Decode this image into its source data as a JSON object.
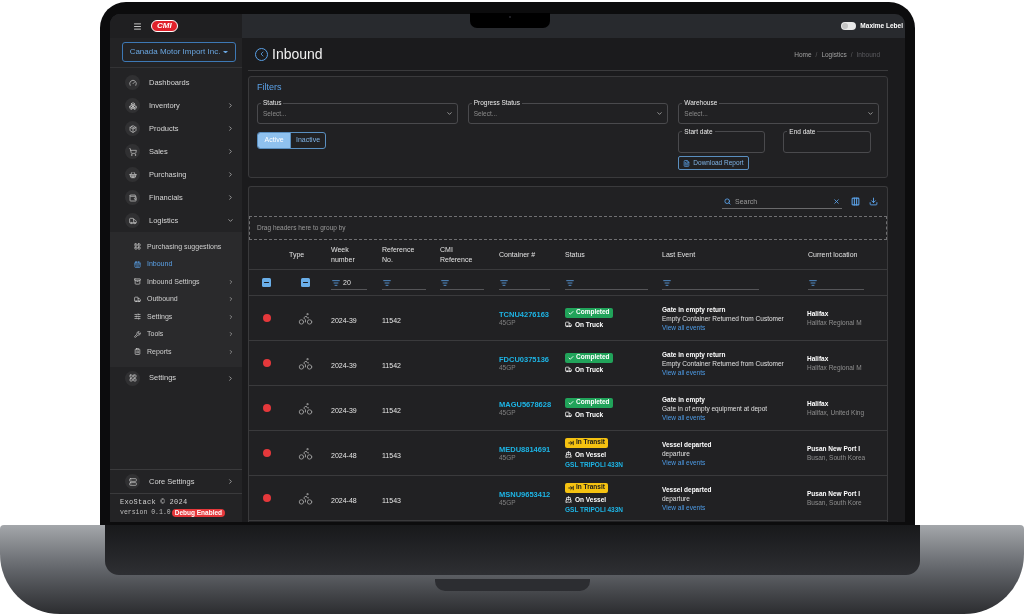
{
  "topbar": {
    "logo": "CMI",
    "theme_switch": {
      "on": false
    },
    "user": "Maxime Lebel"
  },
  "sidebar": {
    "company": "Canada Motor Import Inc.",
    "items": [
      {
        "label": "Dashboards",
        "selected": false
      },
      {
        "label": "Inventory",
        "selected": false,
        "expanded": false
      },
      {
        "label": "Products",
        "selected": false,
        "expanded": false
      },
      {
        "label": "Sales",
        "selected": false,
        "expanded": false
      },
      {
        "label": "Purchasing",
        "selected": false,
        "expanded": false
      },
      {
        "label": "Financials",
        "selected": false,
        "expanded": false
      },
      {
        "label": "Logistics",
        "selected": false,
        "expanded": true,
        "children": [
          {
            "label": "Purchasing suggestions",
            "selected": false
          },
          {
            "label": "Inbound",
            "selected": true
          },
          {
            "label": "Inbound Settings",
            "selected": false,
            "expanded": false
          },
          {
            "label": "Outbound",
            "selected": false,
            "expanded": false
          },
          {
            "label": "Settings",
            "selected": false,
            "expanded": false
          },
          {
            "label": "Tools",
            "selected": false,
            "expanded": false
          },
          {
            "label": "Reports",
            "selected": false,
            "expanded": false
          }
        ]
      },
      {
        "label": "Settings",
        "selected": false,
        "expanded": false
      }
    ],
    "bottom_items": [
      {
        "label": "Core Settings",
        "selected": false,
        "expanded": false
      }
    ],
    "copyright": "ExoStack © 2024",
    "version": "version 0.1.0",
    "debug_badge": "Debug Enabled"
  },
  "page_header": {
    "title": "Inbound",
    "breadcrumb_separator": "/",
    "breadcrumb": [
      {
        "label": "Home",
        "current": false
      },
      {
        "label": "Logistics",
        "current": false
      },
      {
        "label": "Inbound",
        "current": true
      }
    ]
  },
  "filters": {
    "title": "Filters",
    "selects": [
      {
        "label": "Status",
        "placeholder": "Select..."
      },
      {
        "label": "Progress Status",
        "placeholder": "Select..."
      },
      {
        "label": "Warehouse",
        "placeholder": "Select..."
      }
    ],
    "status_toggle": [
      {
        "label": "Active",
        "selected": true
      },
      {
        "label": "Inactive",
        "selected": false
      }
    ],
    "date_fields": [
      {
        "label": "Start date"
      },
      {
        "label": "End date"
      }
    ],
    "download_button": "Download Report"
  },
  "table": {
    "search": {
      "placeholder": "Search"
    },
    "group_hint": "Drag headers here to group by",
    "columns": [
      {
        "kind": "checkbox",
        "indeterminate": true
      },
      {
        "label": "Type",
        "kind": "checkbox",
        "indeterminate": true
      },
      {
        "label": "Week number",
        "kind": "text",
        "filter_value": "20"
      },
      {
        "label": "Reference No.",
        "kind": "text"
      },
      {
        "label": "CMI Reference",
        "kind": "text"
      },
      {
        "label": "Container #",
        "kind": "text"
      },
      {
        "label": "Status",
        "kind": "text"
      },
      {
        "label": "Last Event",
        "kind": "text"
      },
      {
        "label": "Current location",
        "kind": "text"
      }
    ],
    "rows": [
      {
        "color": "#e5383b",
        "week": "2024-39",
        "reference": "11542",
        "container": "TCNU4276163",
        "container_type": "45GP",
        "status": {
          "kind": "completed",
          "label": "Completed"
        },
        "mode": {
          "kind": "truck",
          "label": "On Truck"
        },
        "event_title": "Gate in empty return",
        "event_detail": "Empty Container Returned from Customer",
        "events_link": "View all events",
        "location": "Halifax",
        "location_detail": "Halifax Regional M"
      },
      {
        "color": "#e5383b",
        "week": "2024-39",
        "reference": "11542",
        "container": "FDCU0375136",
        "container_type": "45GP",
        "status": {
          "kind": "completed",
          "label": "Completed"
        },
        "mode": {
          "kind": "truck",
          "label": "On Truck"
        },
        "event_title": "Gate in empty return",
        "event_detail": "Empty Container Returned from Customer",
        "events_link": "View all events",
        "location": "Halifax",
        "location_detail": "Halifax Regional M"
      },
      {
        "color": "#e5383b",
        "week": "2024-39",
        "reference": "11542",
        "container": "MAGU5678628",
        "container_type": "45GP",
        "status": {
          "kind": "completed",
          "label": "Completed"
        },
        "mode": {
          "kind": "truck",
          "label": "On Truck"
        },
        "event_title": "Gate in empty",
        "event_detail": "Gate in of empty equipment at depot",
        "events_link": "View all events",
        "location": "Halifax",
        "location_detail": "Halifax, United King"
      },
      {
        "color": "#e5383b",
        "week": "2024-48",
        "reference": "11543",
        "container": "MEDU8814691",
        "container_type": "45GP",
        "status": {
          "kind": "in_transit",
          "label": "In Transit"
        },
        "mode": {
          "kind": "vessel",
          "label": "On Vessel",
          "vessel": "GSL TRIPOLI 433N"
        },
        "event_title": "Vessel departed",
        "event_detail": "departure",
        "events_link": "View all events",
        "location": "Pusan New Port I",
        "location_detail": "Busan, South Korea"
      },
      {
        "color": "#e5383b",
        "week": "2024-48",
        "reference": "11543",
        "container": "MSNU9653412",
        "container_type": "45GP",
        "status": {
          "kind": "in_transit",
          "label": "In Transit"
        },
        "mode": {
          "kind": "vessel",
          "label": "On Vessel",
          "vessel": "GSL TRIPOLI 433N"
        },
        "event_title": "Vessel departed",
        "event_detail": "departure",
        "events_link": "View all events",
        "location": "Pusan New Port I",
        "location_detail": "Busan, South Kore"
      }
    ]
  }
}
